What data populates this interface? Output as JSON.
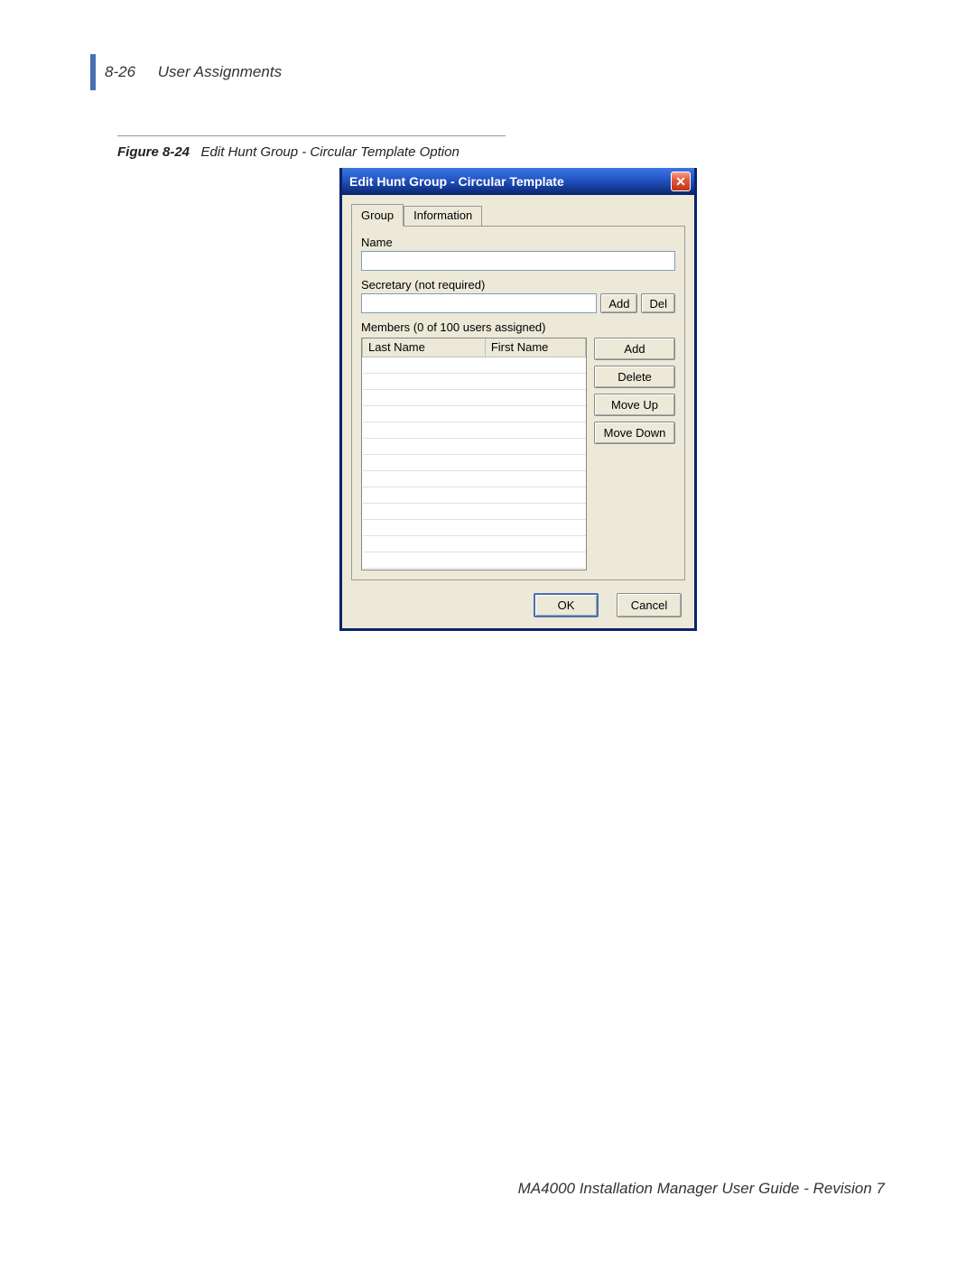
{
  "header": {
    "page_number": "8-26",
    "section_title": "User Assignments"
  },
  "figure": {
    "label": "Figure 8-24",
    "caption": "Edit Hunt Group - Circular Template Option"
  },
  "dialog": {
    "title": "Edit Hunt Group - Circular Template",
    "tabs": {
      "group": "Group",
      "information": "Information"
    },
    "labels": {
      "name": "Name",
      "secretary": "Secretary (not required)",
      "members": "Members (0 of 100 users assigned)"
    },
    "fields": {
      "name_value": "",
      "secretary_value": ""
    },
    "buttons": {
      "sec_add": "Add",
      "sec_del": "Del",
      "add": "Add",
      "delete": "Delete",
      "move_up": "Move Up",
      "move_down": "Move Down",
      "ok": "OK",
      "cancel": "Cancel"
    },
    "grid": {
      "col_last": "Last Name",
      "col_first": "First Name"
    }
  },
  "footer": {
    "text": "MA4000 Installation Manager User Guide - Revision 7"
  }
}
